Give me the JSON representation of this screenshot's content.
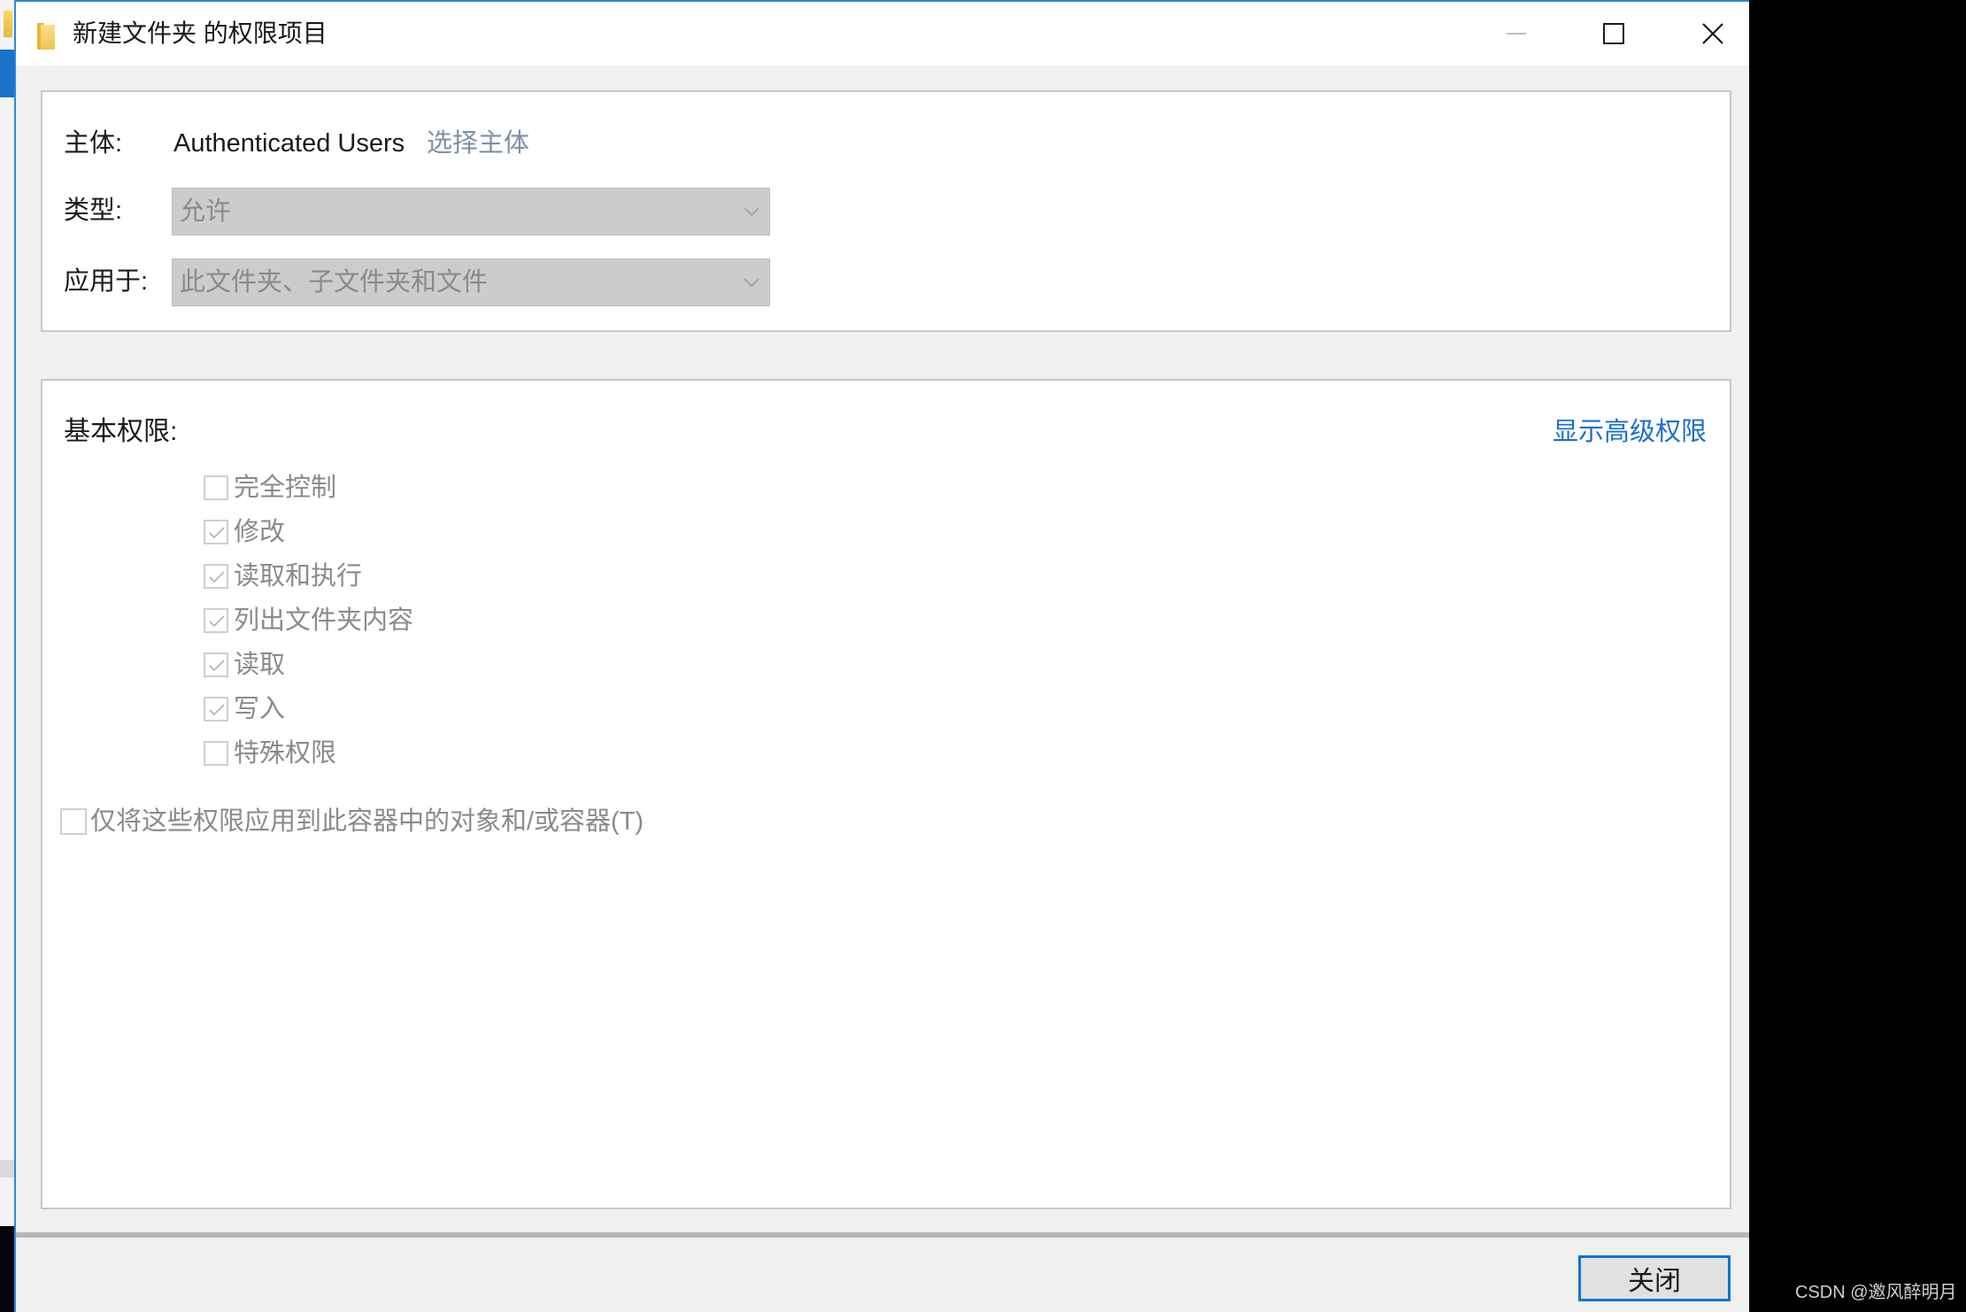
{
  "window": {
    "title": "新建文件夹 的权限项目",
    "icon": "folder-icon",
    "controls": {
      "minimize": "minimize-icon",
      "maximize": "maximize-icon",
      "close": "close-icon"
    }
  },
  "principal": {
    "label": "主体:",
    "value": "Authenticated Users",
    "select_link": "选择主体"
  },
  "type": {
    "label": "类型:",
    "selected": "允许",
    "icon": "chevron-down-icon"
  },
  "applies_to": {
    "label": "应用于:",
    "selected": "此文件夹、子文件夹和文件",
    "icon": "chevron-down-icon"
  },
  "basic_permissions": {
    "title": "基本权限:",
    "advanced_link": "显示高级权限",
    "items": [
      {
        "label": "完全控制",
        "checked": false
      },
      {
        "label": "修改",
        "checked": true
      },
      {
        "label": "读取和执行",
        "checked": true
      },
      {
        "label": "列出文件夹内容",
        "checked": true
      },
      {
        "label": "读取",
        "checked": true
      },
      {
        "label": "写入",
        "checked": true
      },
      {
        "label": "特殊权限",
        "checked": false
      }
    ],
    "apply_only_container": {
      "label": "仅将这些权限应用到此容器中的对象和/或容器(T)",
      "checked": false
    }
  },
  "footer": {
    "close_button": "关闭"
  },
  "watermark": "CSDN @邀风醉明月",
  "colors": {
    "link_blue": "#1a6fd1",
    "disabled_link": "#7f8fa6",
    "focus_border": "#0a73d9",
    "window_border": "#2b88d8"
  }
}
